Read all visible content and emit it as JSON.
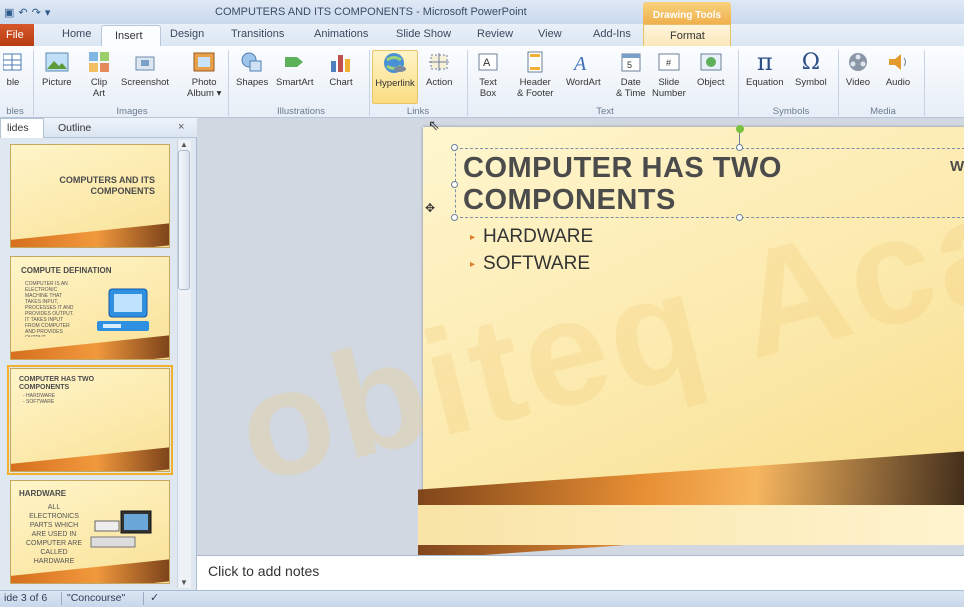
{
  "app": {
    "title": "COMPUTERS AND ITS COMPONENTS - Microsoft PowerPoint",
    "context_group": "Drawing Tools",
    "qat_icons": [
      "save-icon",
      "undo-icon",
      "redo-icon",
      "customize-icon"
    ]
  },
  "tabs": [
    {
      "label": "File"
    },
    {
      "label": "Home"
    },
    {
      "label": "Insert"
    },
    {
      "label": "Design"
    },
    {
      "label": "Transitions"
    },
    {
      "label": "Animations"
    },
    {
      "label": "Slide Show"
    },
    {
      "label": "Review"
    },
    {
      "label": "View"
    },
    {
      "label": "Add-Ins"
    },
    {
      "label": "Format"
    }
  ],
  "ribbon": {
    "groups": {
      "tables": "bles",
      "images": "Images",
      "illustrations": "Illustrations",
      "links": "Links",
      "text": "Text",
      "symbols": "Symbols",
      "media": "Media"
    },
    "buttons": {
      "table": "ble",
      "picture": "Picture",
      "clipart": "Clip\nArt",
      "screenshot": "Screenshot",
      "photo": "Photo\nAlbum ▾",
      "shapes": "Shapes",
      "smartart": "SmartArt",
      "chart": "Chart",
      "hyperlink": "Hyperlink",
      "action": "Action",
      "textbox": "Text\nBox",
      "header": "Header\n& Footer",
      "wordart": "WordArt",
      "datetime": "Date\n& Time",
      "slidenumber": "Slide\nNumber",
      "object": "Object",
      "equation": "Equation",
      "symbol": "Symbol",
      "video": "Video",
      "audio": "Audio"
    }
  },
  "leftpane": {
    "tab_slides": "lides",
    "tab_outline": "Outline",
    "close": "×",
    "thumbs": [
      {
        "title": "COMPUTERS AND ITS COMPONENTS",
        "body": ""
      },
      {
        "title": "COMPUTE DEFINATION",
        "body": "COMPUTER IS AN ELECTRONIC MACHINE THAT TAKES INPUT, PROCESSES IT AND PROVIDES OUTPUT. IT TAKES INPUT FROM COMPUTER AND PROVIDES OUTPUT. PROCESSED INFORMATION IS OUTPUT"
      },
      {
        "title": "COMPUTER HAS TWO COMPONENTS",
        "body": "- HARDWARE\n- SOFTWARE"
      },
      {
        "title": "HARDWARE",
        "body": "ALL ELECTRONICS PARTS WHICH ARE USED IN COMPUTER ARE CALLED HARDWARE"
      }
    ]
  },
  "slide": {
    "title": "COMPUTER HAS TWO COMPONENTS",
    "title_line1": "COMPUTER HAS TWO",
    "title_line2": "COMPONENTS",
    "right_fragment": "W",
    "bullets": [
      "HARDWARE",
      "SOFTWARE"
    ],
    "watermark": "obiteq Aca"
  },
  "notes": {
    "placeholder": "Click to add notes"
  },
  "status": {
    "slide": "ide 3 of 6",
    "theme": "\"Concourse\""
  },
  "colors": {
    "file_tab": "#c8471b",
    "context": "#f0b04d",
    "slide_bg": "#fbe8a8",
    "bullet": "#e07b2b"
  }
}
